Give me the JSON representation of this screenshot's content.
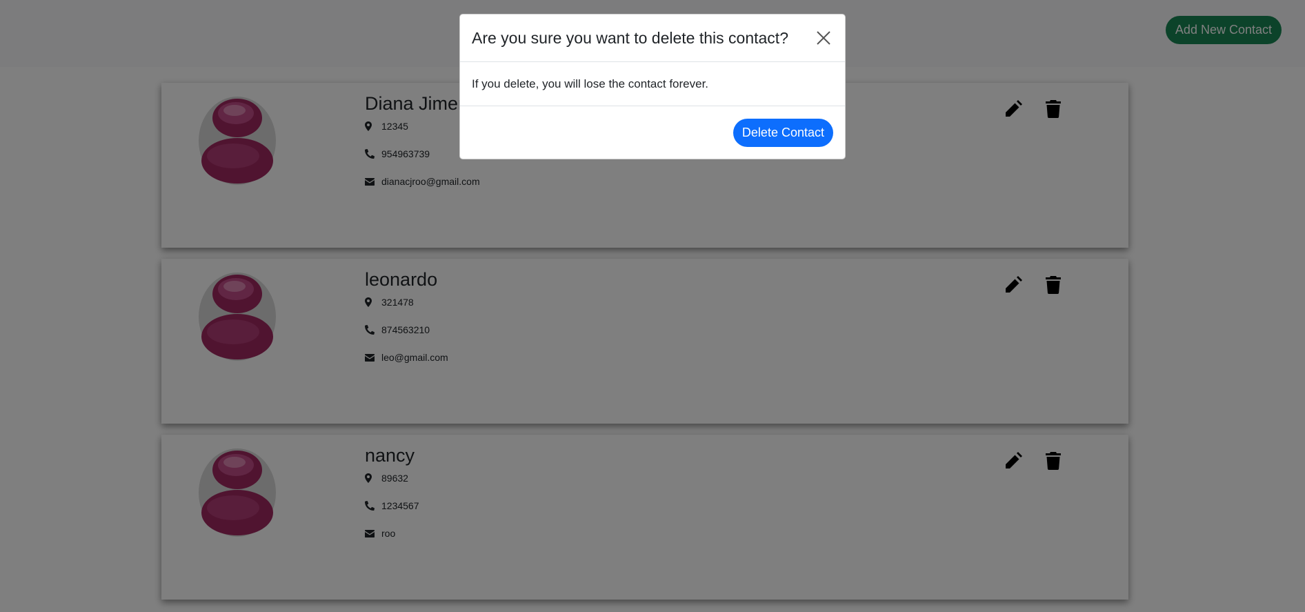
{
  "navbar": {
    "add_button_label": "Add New Contact"
  },
  "contacts": [
    {
      "name": "Diana Jimenez",
      "address": "12345",
      "phone": "954963739",
      "email": "dianacjroo@gmail.com"
    },
    {
      "name": "leonardo",
      "address": "321478",
      "phone": "874563210",
      "email": "leo@gmail.com"
    },
    {
      "name": "nancy",
      "address": "89632",
      "phone": "1234567",
      "email": "roo"
    }
  ],
  "icons": {
    "address": "map-marker-icon",
    "phone": "phone-icon",
    "email": "envelope-icon",
    "edit": "pencil-icon",
    "delete": "trash-icon",
    "avatar": "user-avatar",
    "close": "close-icon"
  },
  "modal": {
    "title": "Are you sure you want to delete this contact?",
    "body": "If you delete, you will lose the contact forever.",
    "confirm_label": "Delete Contact"
  },
  "colors": {
    "add_button": "#198754",
    "delete_button": "#0d6efd",
    "avatar": "#b0306b"
  }
}
